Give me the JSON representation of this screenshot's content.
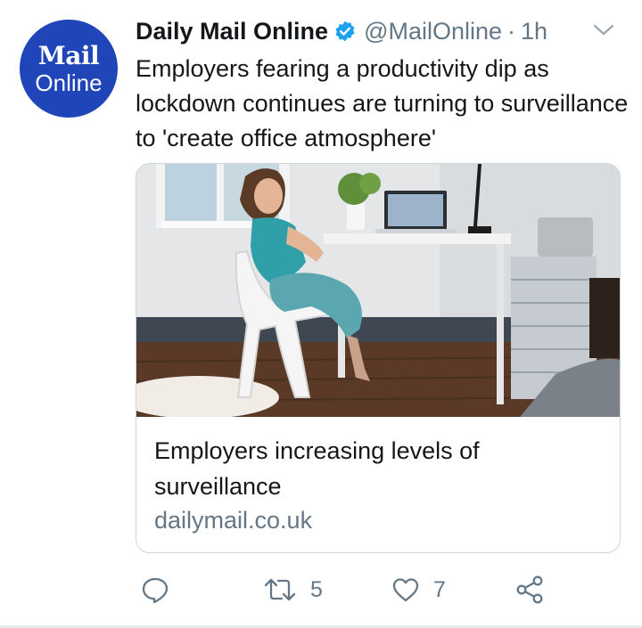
{
  "avatar": {
    "line1": "Mail",
    "line2": "Online",
    "bg_color": "#1f45b8"
  },
  "header": {
    "display_name": "Daily Mail Online",
    "verified_icon": "verified-badge-icon",
    "handle": "@MailOnline",
    "separator": "·",
    "time": "1h",
    "menu_icon": "chevron-down-icon"
  },
  "tweet": {
    "text": "Employers fearing a productivity dip as lockdown continues are turning to surveillance to 'create office atmosphere'"
  },
  "card": {
    "image_icon": "photo-woman-on-phone-at-home-desk",
    "title": "Employers increasing levels of surveillance",
    "domain": "dailymail.co.uk"
  },
  "actions": {
    "reply": {
      "icon": "reply-icon",
      "count": ""
    },
    "retweet": {
      "icon": "retweet-icon",
      "count": "5"
    },
    "like": {
      "icon": "heart-icon",
      "count": "7"
    },
    "share": {
      "icon": "share-icon"
    }
  },
  "colors": {
    "text": "#14171a",
    "secondary": "#657786",
    "verified": "#1da1f2",
    "border": "#ccd6dd"
  }
}
